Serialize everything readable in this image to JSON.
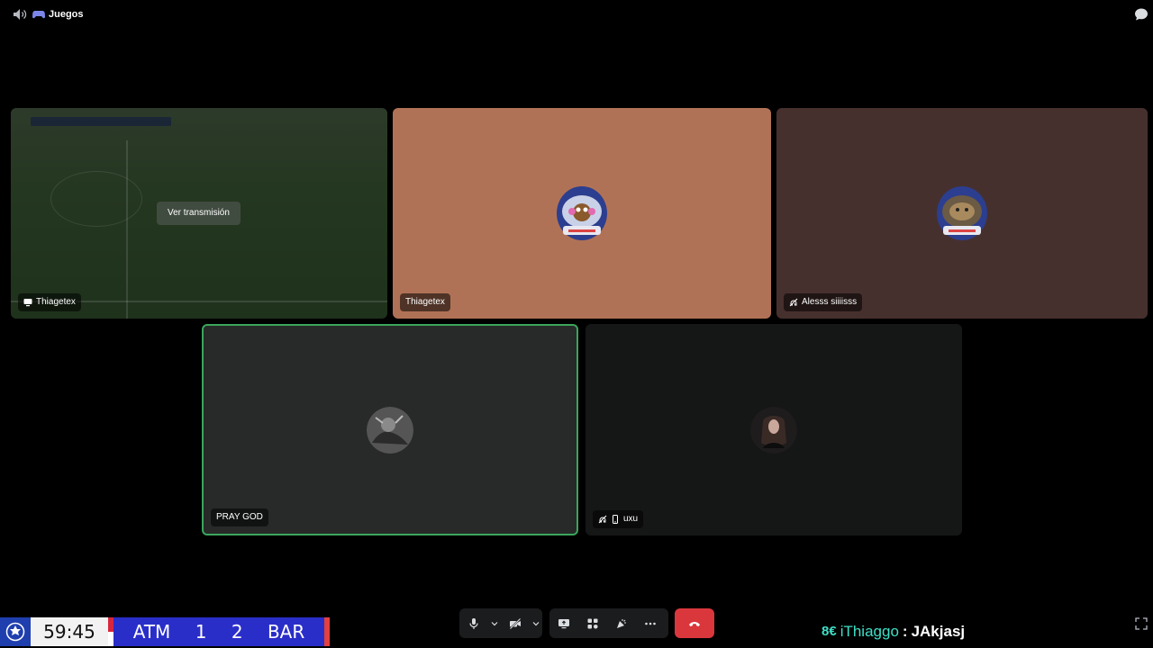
{
  "header": {
    "title": "Juegos",
    "speaker_icon": "speaker-icon",
    "game_icon": "gamepad-icon",
    "chat_icon": "chat-bubble-icon"
  },
  "tiles": [
    {
      "name": "Thiagetex",
      "icon": "screen-share-icon",
      "action": "Ver transmisión"
    },
    {
      "name": "Thiagetex",
      "icon": ""
    },
    {
      "name": "Alesss siiiisss",
      "icon": "deafened-icon"
    },
    {
      "name": "PRAY GOD",
      "icon": "",
      "speaking": true,
      "speaking_color": "#3ba55c"
    },
    {
      "name": "uxu",
      "icon": "deafened-mobile-icon"
    }
  ],
  "scoreboard": {
    "clock": "59:45",
    "home": "ATM",
    "home_score": "1",
    "away_score": "2",
    "away": "BAR",
    "logo_icon": "champions-league-icon"
  },
  "controls": {
    "mic_icon": "microphone-icon",
    "camera_icon": "camera-off-icon",
    "share_icon": "screen-share-icon",
    "activities_icon": "activities-icon",
    "soundboard_icon": "soundboard-icon",
    "more_icon": "more-icon",
    "hangup_icon": "hang-up-icon",
    "hangup_color": "#da373c"
  },
  "chat": {
    "badge": "8€",
    "user": "iThiaggo",
    "separator": " : ",
    "message": "JAkjasj"
  },
  "expand_icon": "fullscreen-icon"
}
